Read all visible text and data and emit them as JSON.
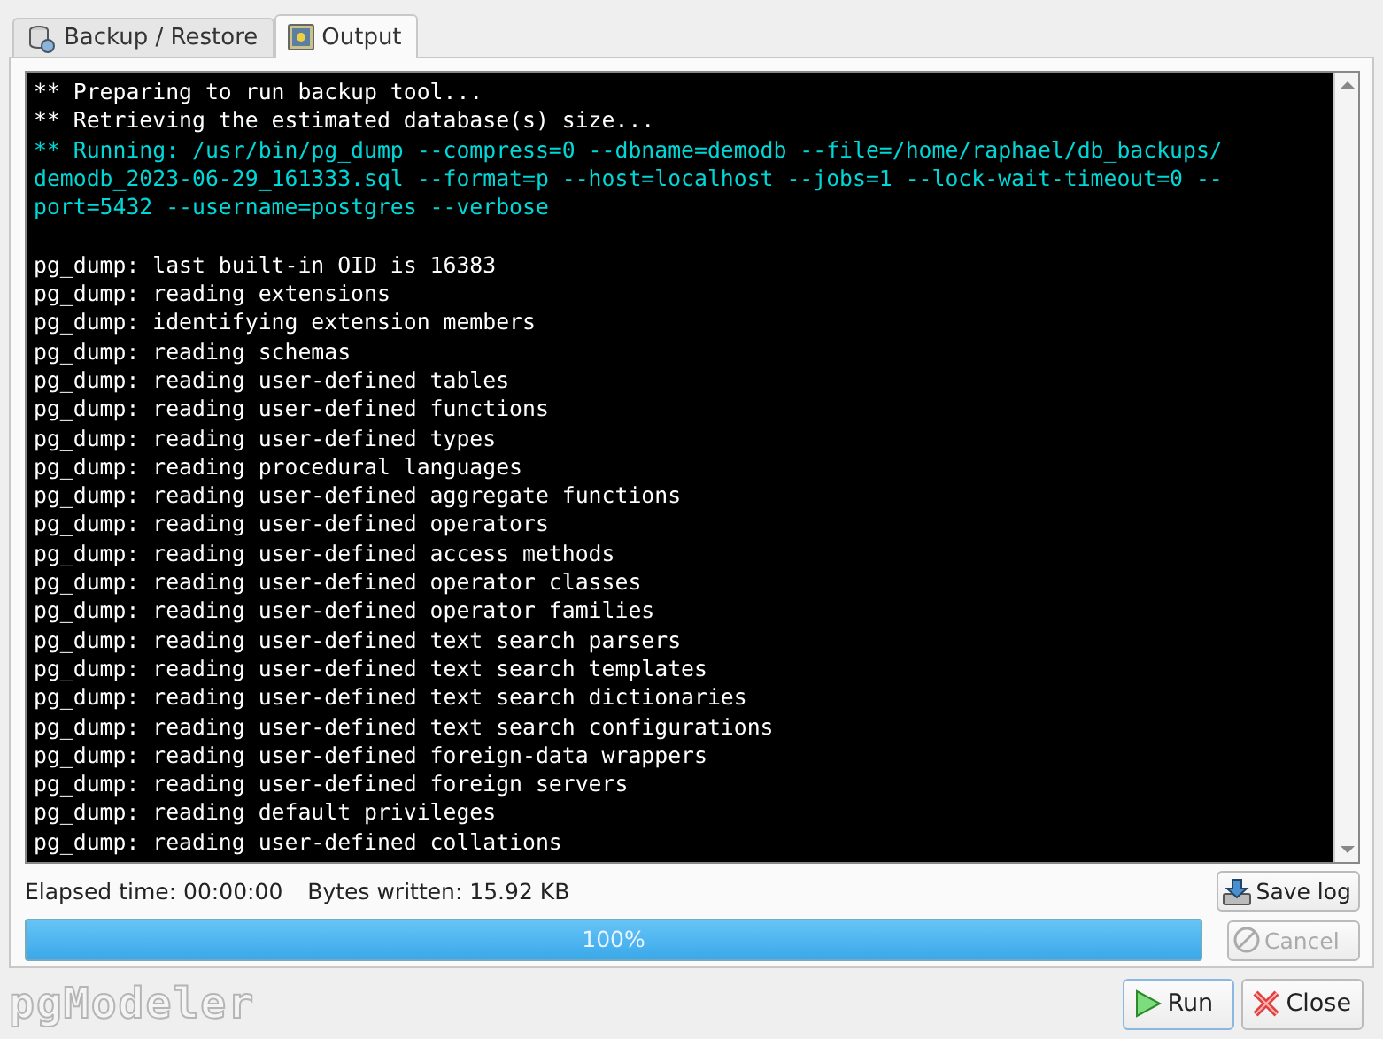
{
  "tabs": [
    {
      "label": "Backup / Restore",
      "selected": false,
      "kind": "backup"
    },
    {
      "label": "Output",
      "selected": true,
      "kind": "output"
    }
  ],
  "console": {
    "messages": [
      {
        "kind": "info",
        "text": "** Preparing to run backup tool..."
      },
      {
        "kind": "info",
        "text": "** Retrieving the estimated database(s) size..."
      },
      {
        "kind": "command",
        "text": "** Running: /usr/bin/pg_dump --compress=0 --dbname=demodb --file=/home/raphael/db_backups/"
      },
      {
        "kind": "command",
        "text": "demodb_2023-06-29_161333.sql --format=p --host=localhost --jobs=1 --lock-wait-timeout=0 --"
      },
      {
        "kind": "command",
        "text": "port=5432 --username=postgres --verbose"
      }
    ],
    "output": [
      "pg_dump: last built-in OID is 16383",
      "pg_dump: reading extensions",
      "pg_dump: identifying extension members",
      "pg_dump: reading schemas",
      "pg_dump: reading user-defined tables",
      "pg_dump: reading user-defined functions",
      "pg_dump: reading user-defined types",
      "pg_dump: reading procedural languages",
      "pg_dump: reading user-defined aggregate functions",
      "pg_dump: reading user-defined operators",
      "pg_dump: reading user-defined access methods",
      "pg_dump: reading user-defined operator classes",
      "pg_dump: reading user-defined operator families",
      "pg_dump: reading user-defined text search parsers",
      "pg_dump: reading user-defined text search templates",
      "pg_dump: reading user-defined text search dictionaries",
      "pg_dump: reading user-defined text search configurations",
      "pg_dump: reading user-defined foreign-data wrappers",
      "pg_dump: reading user-defined foreign servers",
      "pg_dump: reading default privileges",
      "pg_dump: reading user-defined collations"
    ]
  },
  "status": {
    "elapsed": "Elapsed time: 00:00:00",
    "bytes": "Bytes written: 15.92 KB"
  },
  "save_button": {
    "label": "Save log",
    "disabled": false
  },
  "progress": {
    "level": 1,
    "label": "100%"
  },
  "cancel_button": {
    "label": "Cancel",
    "disabled": true
  },
  "logo": "pgModeler",
  "run_button": {
    "label": "Run",
    "disabled": false
  },
  "close_button": {
    "label": "Close",
    "disabled": false
  }
}
